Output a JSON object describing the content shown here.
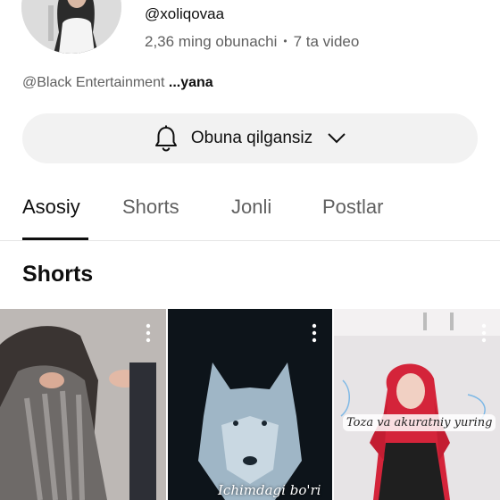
{
  "channel": {
    "handle": "@xoliqovaa",
    "subscribers": "2,36 ming obunachi",
    "separator": "•",
    "videos": "7 ta video",
    "links_prefix": "@Black Entertainment",
    "links_more": " ...yana"
  },
  "subscribe": {
    "label": "Obuna qilgansiz",
    "bell_icon": "bell-icon",
    "chevron_icon": "chevron-down-icon"
  },
  "tabs": [
    {
      "label": "Asosiy",
      "active": true
    },
    {
      "label": "Shorts",
      "active": false
    },
    {
      "label": "Jonli",
      "active": false
    },
    {
      "label": "Postlar",
      "active": false
    }
  ],
  "section": {
    "title": "Shorts"
  },
  "shorts": [
    {
      "caption": "",
      "theme": "hair-braiding",
      "menu_icon": "more-vert-icon"
    },
    {
      "caption": "Ichimdagi bo'ri",
      "theme": "wolf",
      "menu_icon": "more-vert-icon"
    },
    {
      "caption": "Toza va akuratniy yuring",
      "theme": "red-hair-girl",
      "menu_icon": "more-vert-icon"
    }
  ],
  "colors": {
    "text_primary": "#0f0f0f",
    "text_secondary": "#606060",
    "pill_bg": "#f2f2f2",
    "divider": "#e5e5e5"
  }
}
